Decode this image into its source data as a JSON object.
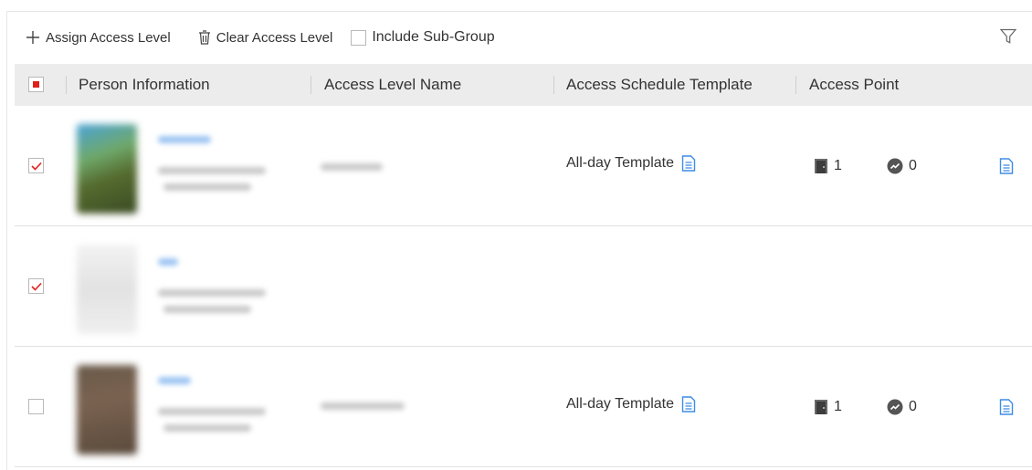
{
  "toolbar": {
    "assign_label": "Assign Access Level",
    "clear_label": "Clear Access Level",
    "include_subgroup_label": "Include Sub-Group"
  },
  "table": {
    "columns": [
      "Person Information",
      "Access Level Name",
      "Access Schedule Template",
      "Access Point"
    ],
    "rows": [
      {
        "checked": true,
        "schedule": "All-day Template",
        "door_count": "1",
        "elevator_count": "0",
        "has_details": true
      },
      {
        "checked": true,
        "schedule": "",
        "door_count": "",
        "elevator_count": "",
        "has_details": false
      },
      {
        "checked": false,
        "schedule": "All-day Template",
        "door_count": "1",
        "elevator_count": "0",
        "has_details": true
      }
    ]
  },
  "colors": {
    "accent_blue": "#3d8ce6",
    "check_red": "#e0201b",
    "header_bg": "#ececec"
  },
  "icons": {
    "assign": "plus-icon",
    "clear": "trash-icon",
    "filter": "filter-icon",
    "schedule": "document-icon",
    "door": "door-icon",
    "elevator": "elevator-icon",
    "details": "document-icon"
  }
}
